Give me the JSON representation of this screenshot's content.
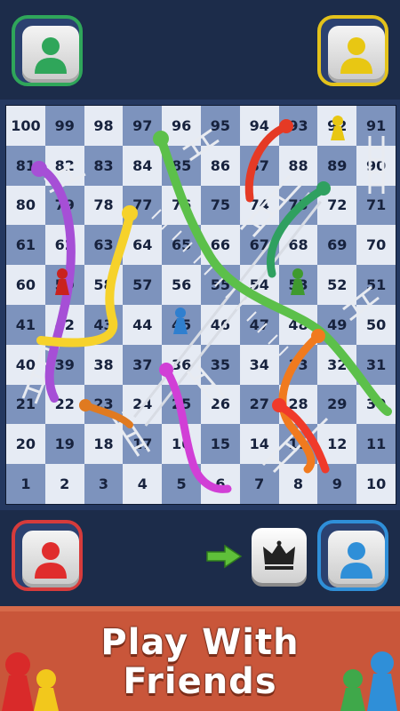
{
  "board": {
    "rows": [
      [
        100,
        99,
        98,
        97,
        96,
        95,
        94,
        93,
        92,
        91
      ],
      [
        81,
        82,
        83,
        84,
        85,
        86,
        87,
        88,
        89,
        90
      ],
      [
        80,
        79,
        78,
        77,
        76,
        75,
        74,
        73,
        72,
        71
      ],
      [
        61,
        62,
        63,
        64,
        65,
        66,
        67,
        68,
        69,
        70
      ],
      [
        60,
        59,
        58,
        57,
        56,
        55,
        54,
        53,
        52,
        51
      ],
      [
        41,
        42,
        43,
        44,
        45,
        46,
        47,
        48,
        49,
        50
      ],
      [
        40,
        39,
        38,
        37,
        36,
        35,
        34,
        33,
        32,
        31
      ],
      [
        21,
        22,
        23,
        24,
        25,
        26,
        27,
        28,
        29,
        30
      ],
      [
        20,
        19,
        18,
        17,
        16,
        15,
        14,
        13,
        12,
        11
      ],
      [
        1,
        2,
        3,
        4,
        5,
        6,
        7,
        8,
        9,
        10
      ]
    ]
  },
  "players": {
    "top_left": {
      "color": "#2fa65a",
      "label": "green-player"
    },
    "top_right": {
      "color": "#e3c21b",
      "label": "yellow-player"
    },
    "bottom_left": {
      "color": "#d63b3b",
      "label": "red-player"
    },
    "bottom_right": {
      "color": "#2f8fd8",
      "label": "blue-player"
    }
  },
  "banner": {
    "line1": "Play With",
    "line2": "Friends"
  },
  "colors": {
    "background": "#1c2c4a",
    "cell_light": "#e6ebf4",
    "cell_dark": "#7d93bd",
    "banner": "#c9563a"
  }
}
